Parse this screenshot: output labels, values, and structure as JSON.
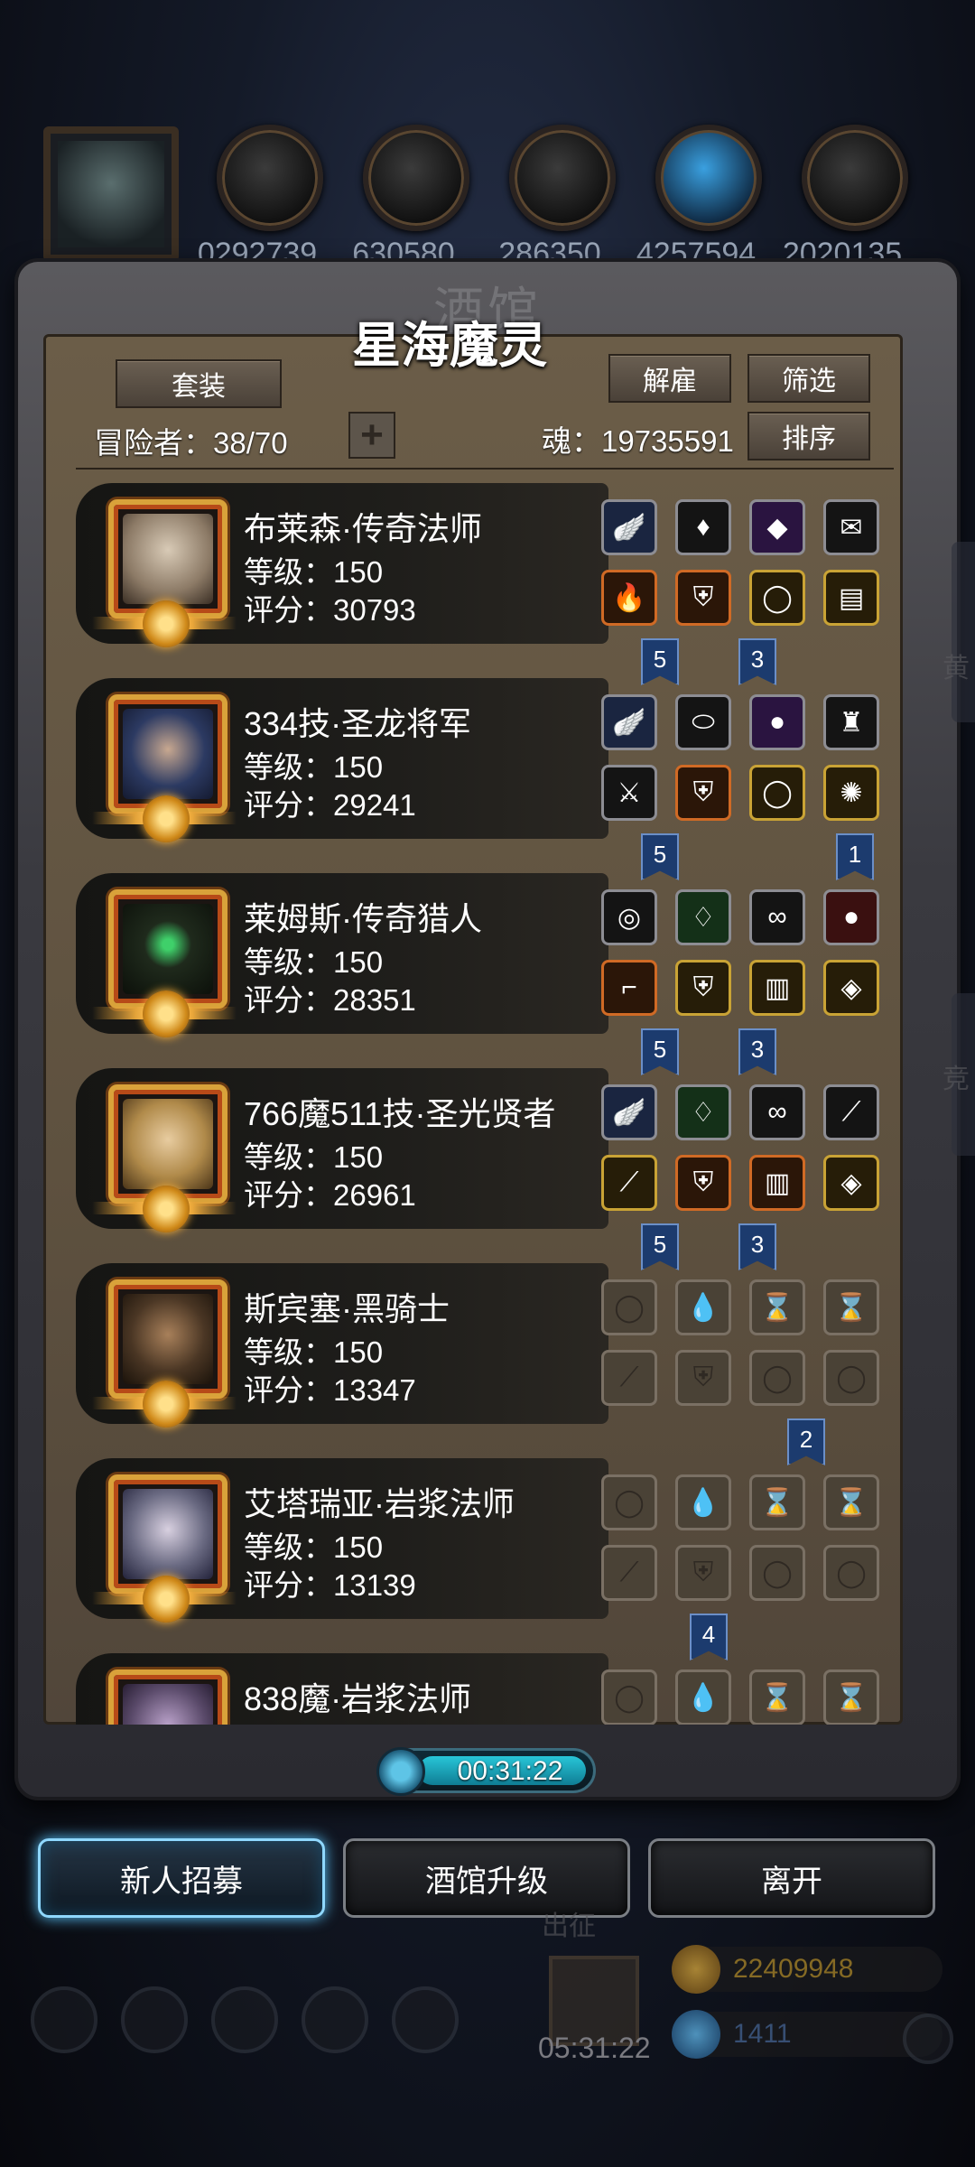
{
  "colors": {
    "panel_bg": "#5e513f",
    "card_bg": "#1f1e1b",
    "badge_blue": "#1c3b6e",
    "timer_cyan": "#28c6d8",
    "recruit_glow": "#5bc8ff"
  },
  "top_resources": [
    "0292739",
    "630580",
    "286350",
    "4257594",
    "2020135"
  ],
  "panel": {
    "ghost_title": "酒馆",
    "title": "星海魔灵",
    "outfit_label": "套装",
    "dismiss_label": "解雇",
    "filter_label": "筛选",
    "sort_label": "排序",
    "adventurers_label": "冒险者：38/70",
    "soul_label": "魂：19735591"
  },
  "heroes": [
    {
      "name": "布莱森·传奇法师",
      "level": "等级：150",
      "score": "评分：30793",
      "badges": [
        "5",
        "3"
      ],
      "face": "#8c7a66"
    },
    {
      "name": "334技·圣龙将军",
      "level": "等级：150",
      "score": "评分：29241",
      "badges": [
        "5",
        "1"
      ],
      "face": "#2c3a62"
    },
    {
      "name": "莱姆斯·传奇猎人",
      "level": "等级：150",
      "score": "评分：28351",
      "badges": [
        "5",
        "3"
      ],
      "face": "#1f2a1c"
    },
    {
      "name": "766魔511技·圣光贤者",
      "level": "等级：150",
      "score": "评分：26961",
      "badges": [
        "5",
        "3"
      ],
      "face": "#b08a4a"
    },
    {
      "name": "斯宾塞·黑骑士",
      "level": "等级：150",
      "score": "评分：13347",
      "badges": [
        "2"
      ],
      "face": "#4a3624"
    },
    {
      "name": "艾塔瑞亚·岩浆法师",
      "level": "等级：150",
      "score": "评分：13139",
      "badges": [
        "4"
      ],
      "face": "#6a6a82"
    },
    {
      "name": "838魔·岩浆法师",
      "level": "",
      "score": "",
      "badges": [],
      "face": "#5a4a6a"
    }
  ],
  "timer": "00:31:22",
  "buttons": {
    "recruit": "新人招募",
    "upgrade": "酒馆升级",
    "leave": "离开"
  },
  "background_hud": {
    "gift_timer": "05:31:22",
    "gold": "22409948",
    "gems": "1411",
    "behind_label": "出征",
    "side_label_1": "竞",
    "side_label_2": "黄"
  }
}
